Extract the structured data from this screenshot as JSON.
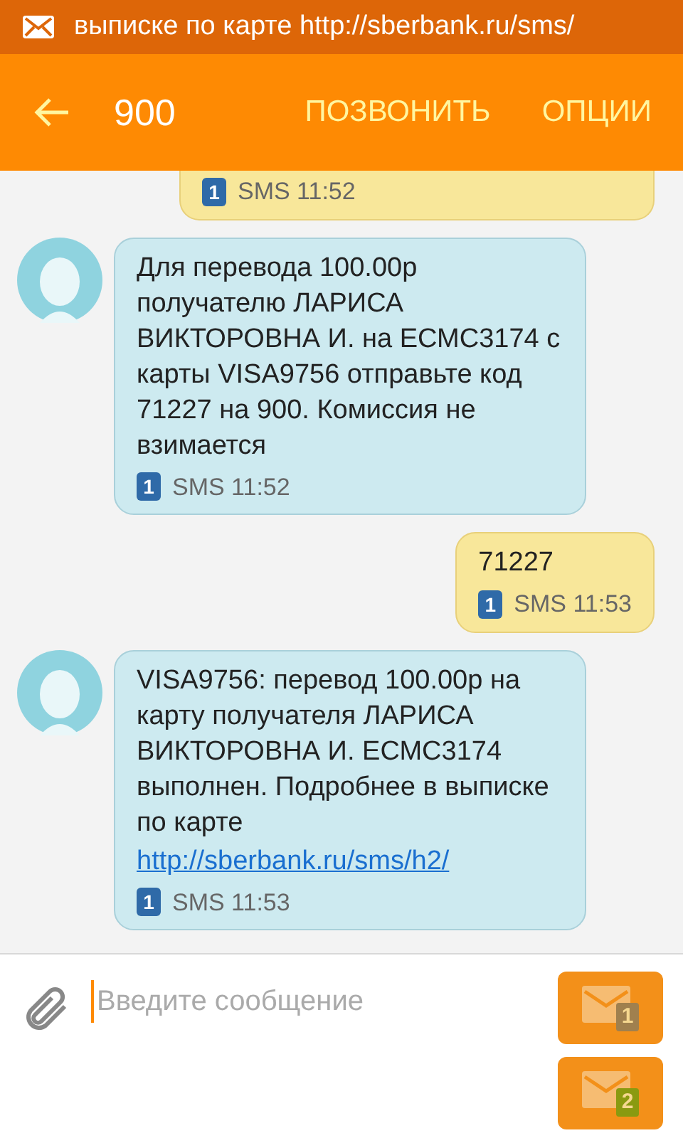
{
  "status_bar": {
    "notification": "выписке по карте http://sberbank.ru/sms/"
  },
  "app_bar": {
    "title": "900",
    "actions": [
      "ПОЗВОНИТЬ",
      "ОПЦИИ"
    ]
  },
  "messages": [
    {
      "kind": "clipped",
      "sim": "1",
      "meta": "SMS 11:52"
    },
    {
      "kind": "incoming",
      "text": "Для перевода 100.00р получателю ЛАРИСА ВИКТОРОВНА И. на ЕСМС3174 с карты VISA9756 отправьте код 71227 на 900. Комиссия не взимается",
      "sim": "1",
      "meta": "SMS 11:52"
    },
    {
      "kind": "outgoing",
      "text": "71227",
      "sim": "1",
      "meta": "SMS 11:53"
    },
    {
      "kind": "incoming",
      "text": "VISA9756: перевод 100.00р на карту получателя ЛАРИСА ВИКТОРОВНА И. ЕСМС3174 выполнен. Подробнее в выписке по карте",
      "link": "http://sberbank.ru/sms/h2/",
      "sim": "1",
      "meta": "SMS 11:53"
    }
  ],
  "composer": {
    "placeholder": "Введите сообщение"
  },
  "send_buttons": [
    {
      "sim": "1",
      "color": "#a0804e"
    },
    {
      "sim": "2",
      "color": "#8a9a10"
    }
  ]
}
